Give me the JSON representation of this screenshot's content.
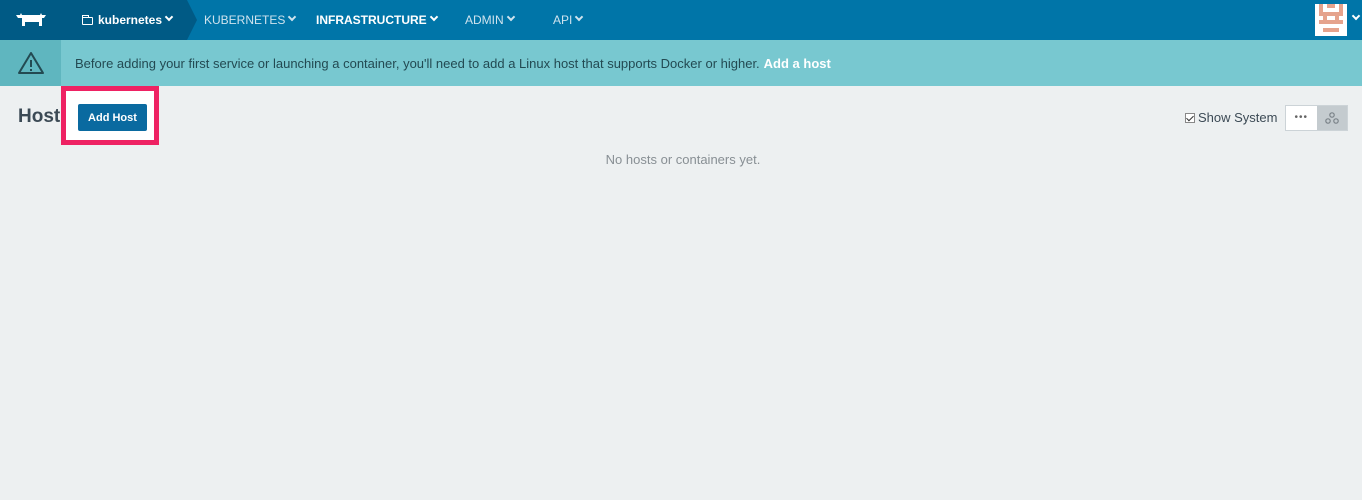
{
  "nav": {
    "environment": "kubernetes",
    "items": [
      {
        "label": "KUBERNETES"
      },
      {
        "label": "INFRASTRUCTURE"
      },
      {
        "label": "ADMIN"
      },
      {
        "label": "API"
      }
    ],
    "active_item": "INFRASTRUCTURE",
    "logo_icon": "cow-logo-icon",
    "avatar_icon": "user-avatar-icon"
  },
  "banner": {
    "message": "Before adding your first service or launching a container, you'll need to add a Linux host that supports Docker or higher.",
    "link": "Add a host",
    "icon": "warning-icon"
  },
  "page": {
    "title": "Hosts",
    "add_button": "Add Host",
    "show_system_label": "Show System",
    "show_system_checked": true,
    "view_modes": [
      "list-dots-icon",
      "cluster-icon"
    ],
    "selected_view": "cluster-icon",
    "empty_message": "No hosts or containers yet."
  },
  "colors": {
    "topbar": "#0075a8",
    "topbar_dark": "#005a85",
    "banner": "#78c8d0",
    "button": "#0a6aa0",
    "highlight": "#ee2263"
  }
}
